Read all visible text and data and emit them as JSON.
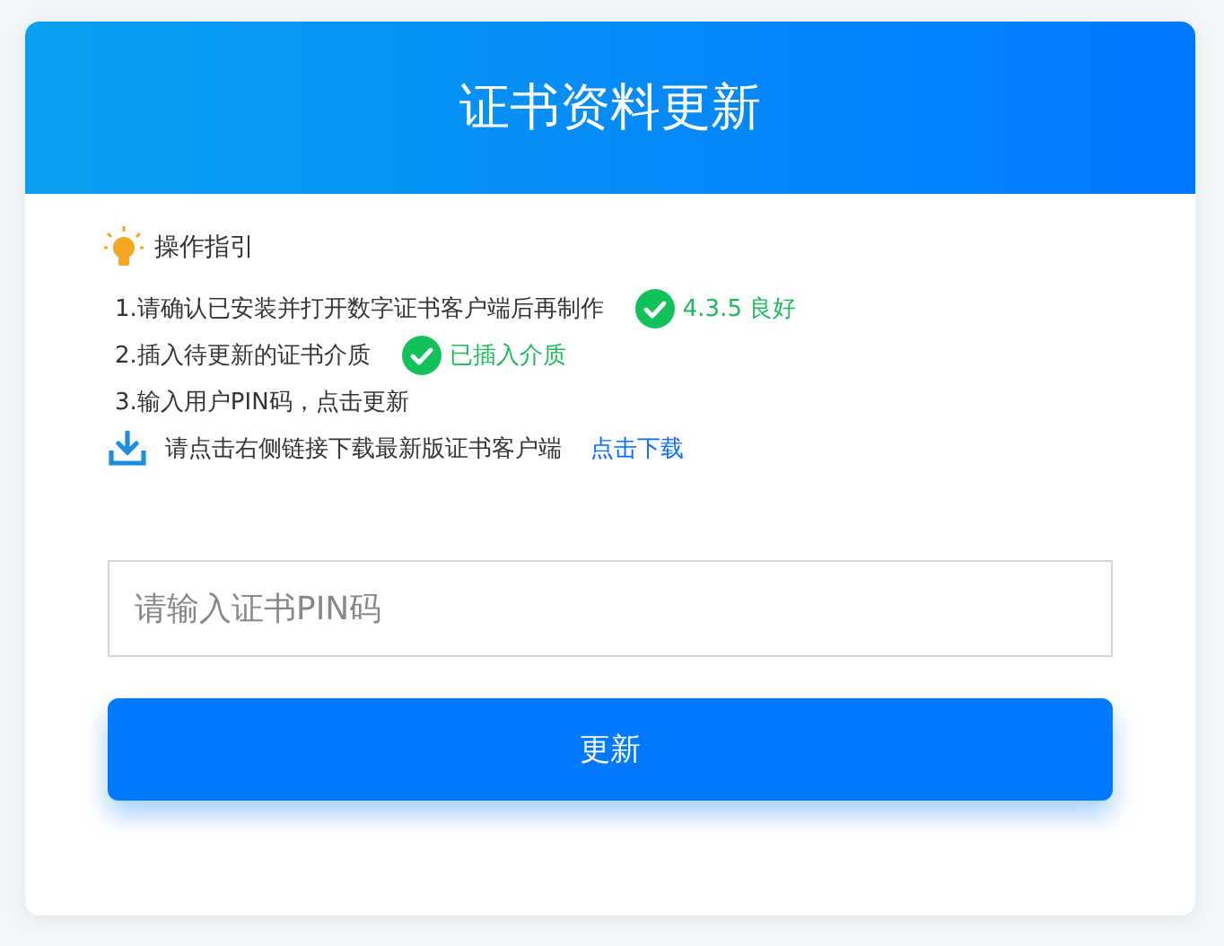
{
  "header": {
    "title": "证书资料更新"
  },
  "guide": {
    "title": "操作指引",
    "steps": [
      {
        "text": "1.请确认已安装并打开数字证书客户端后再制作",
        "status": {
          "text": "4.3.5 良好",
          "ok": true
        }
      },
      {
        "text": "2.插入待更新的证书介质",
        "status": {
          "text": "已插入介质",
          "ok": true
        }
      },
      {
        "text": "3.输入用户PIN码，点击更新"
      }
    ],
    "download": {
      "text": "请点击右侧链接下载最新版证书客户端",
      "link": "点击下载"
    }
  },
  "pin_field": {
    "placeholder": "请输入证书PIN码"
  },
  "buttons": [
    "更新"
  ]
}
